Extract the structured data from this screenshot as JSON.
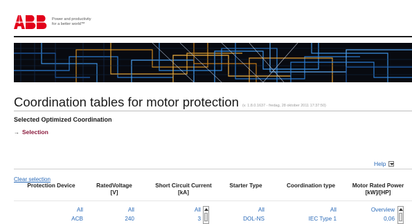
{
  "brand": {
    "logo_text": "ABB",
    "tagline_line1": "Power and productivity",
    "tagline_line2": "for a better world™",
    "logo_color": "#e2001a"
  },
  "page": {
    "title": "Coordination tables for motor protection",
    "version": "(v. 1.8.0.1637 - fredag, 28 oktober 2011 17:37:50)",
    "section_title": "Selected Optimized Coordination",
    "selection_arrow": "→",
    "selection_label": "Selection",
    "help_label": "Help",
    "clear_selection": "Clear selection"
  },
  "table": {
    "columns": [
      {
        "label_line1": "Protection Device",
        "label_line2": ""
      },
      {
        "label_line1": "RatedVoltage",
        "label_line2": "[V]"
      },
      {
        "label_line1": "Short Circuit Current",
        "label_line2": "[kA]"
      },
      {
        "label_line1": "Starter Type",
        "label_line2": ""
      },
      {
        "label_line1": "Coordination type",
        "label_line2": ""
      },
      {
        "label_line1": "Motor Rated Power",
        "label_line2": "[kW]/[HP]"
      }
    ],
    "rows": [
      [
        "All",
        "All",
        "All",
        "All",
        "All",
        "Overview"
      ],
      [
        "ACB",
        "240",
        "3",
        "DOL-NS",
        "IEC Type 1",
        "0,06"
      ]
    ]
  },
  "colors": {
    "accent_link": "#2a6ab8",
    "selection_link": "#8a1a3c",
    "banner_bg": "#080a10"
  }
}
